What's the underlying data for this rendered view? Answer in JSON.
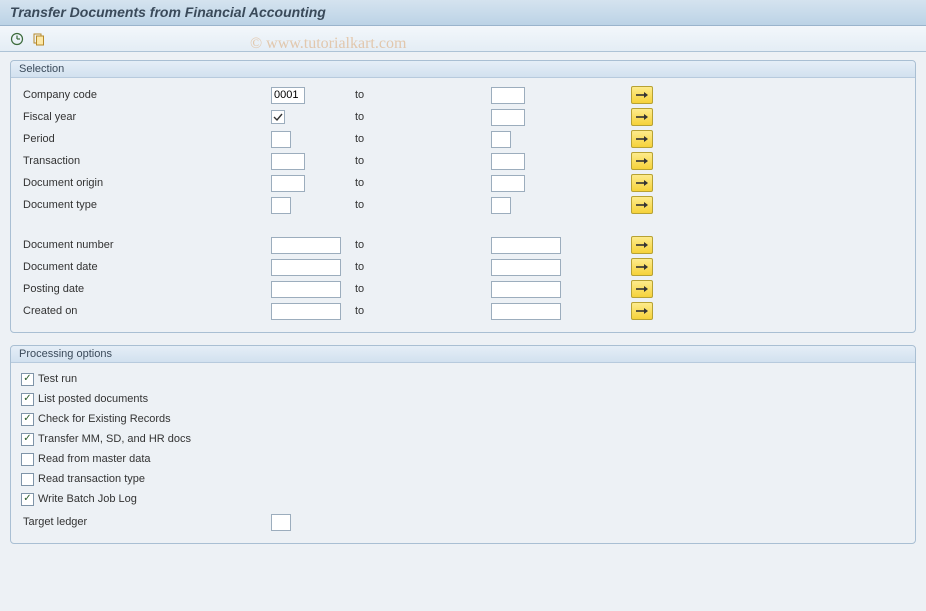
{
  "title": "Transfer Documents from Financial Accounting",
  "watermark": "© www.tutorialkart.com",
  "selection": {
    "header": "Selection",
    "to_label": "to",
    "rows": [
      {
        "label": "Company code",
        "from": "0001",
        "to": "",
        "size": "w40"
      },
      {
        "label": "Fiscal year",
        "checkbox": true,
        "to": "",
        "size": "w40"
      },
      {
        "label": "Period",
        "from": "",
        "to": "",
        "size": "w20"
      },
      {
        "label": "Transaction",
        "from": "",
        "to": "",
        "size": "w40"
      },
      {
        "label": "Document origin",
        "from": "",
        "to": "",
        "size": "w40"
      },
      {
        "label": "Document type",
        "from": "",
        "to": "",
        "size": "w20"
      }
    ],
    "rows2": [
      {
        "label": "Document number",
        "from": "",
        "to": "",
        "size": "w70"
      },
      {
        "label": "Document date",
        "from": "",
        "to": "",
        "size": "w70"
      },
      {
        "label": "Posting date",
        "from": "",
        "to": "",
        "size": "w70"
      },
      {
        "label": "Created on",
        "from": "",
        "to": "",
        "size": "w70"
      }
    ]
  },
  "processing": {
    "header": "Processing options",
    "options": [
      {
        "label": "Test run",
        "checked": true
      },
      {
        "label": "List posted documents",
        "checked": true
      },
      {
        "label": "Check for Existing Records",
        "checked": true
      },
      {
        "label": "Transfer MM, SD, and HR docs",
        "checked": true
      },
      {
        "label": "Read from master data",
        "checked": false
      },
      {
        "label": "Read transaction type",
        "checked": false
      },
      {
        "label": "Write Batch Job Log",
        "checked": true
      }
    ],
    "target_ledger_label": "Target ledger",
    "target_ledger_value": ""
  }
}
